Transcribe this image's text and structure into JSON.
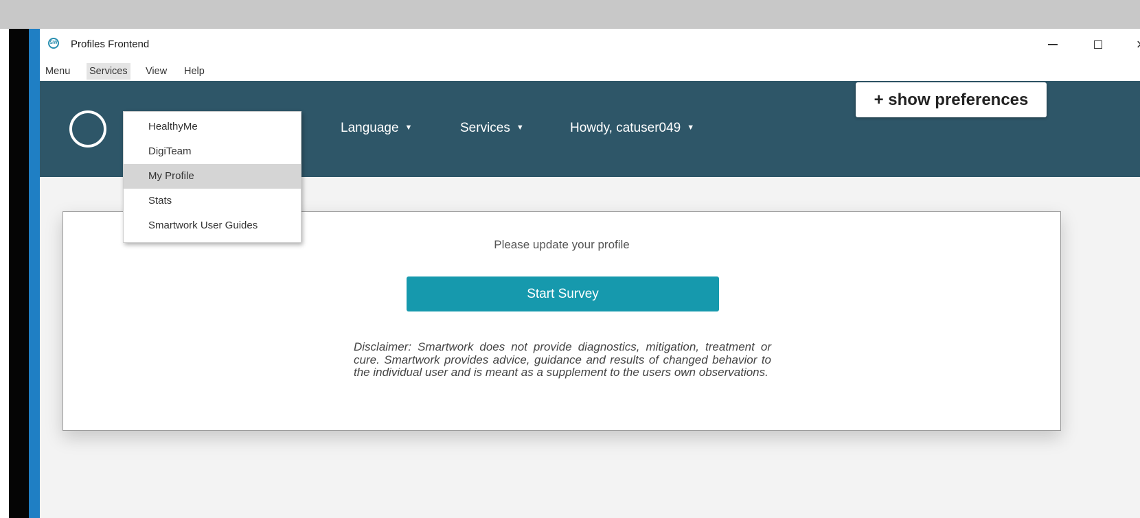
{
  "window": {
    "title": "Profiles Frontend",
    "icon": "app-logo-icon",
    "controls": {
      "minimize": "minimize-icon",
      "maximize": "maximize-icon",
      "close": "×"
    }
  },
  "menubar": {
    "items": [
      {
        "label": "Menu"
      },
      {
        "label": "Services",
        "active": true
      },
      {
        "label": "View"
      },
      {
        "label": "Help"
      }
    ]
  },
  "services_menu": {
    "items": [
      {
        "label": "HealthyMe"
      },
      {
        "label": "DigiTeam"
      },
      {
        "label": "My Profile",
        "highlighted": true
      },
      {
        "label": "Stats"
      },
      {
        "label": "Smartwork User Guides"
      }
    ]
  },
  "navbar": {
    "language_label": "Language",
    "services_label": "Services",
    "user_label": "Howdy, catuser049",
    "caret": "▼",
    "show_preferences_label": "+ show preferences",
    "background_color": "#2e5668"
  },
  "main": {
    "prompt": "Please update your profile",
    "start_survey_label": "Start Survey",
    "start_survey_color": "#1699ad",
    "disclaimer": "Disclaimer: Smartwork does not provide diagnostics, mitigation, treatment or cure. Smartwork provides advice, guidance and results of changed behavior to the individual user and is meant as a supplement to the users own observations."
  }
}
